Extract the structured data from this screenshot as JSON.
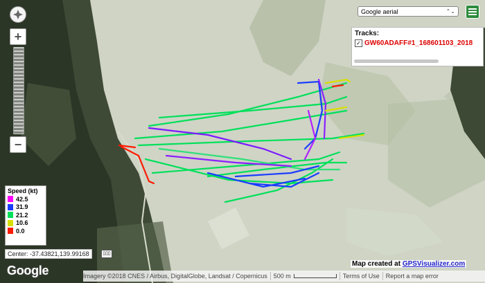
{
  "controls": {
    "map_type": "Google aerial"
  },
  "tracks_panel": {
    "title": "Tracks:",
    "track_name": "GW60ADAFF#1_168601103_2018"
  },
  "legend": {
    "title": "Speed (kt)",
    "items": [
      {
        "value": "42.5",
        "color": "#ff00ff"
      },
      {
        "value": "31.9",
        "color": "#1a3cff"
      },
      {
        "value": "21.2",
        "color": "#00e05a"
      },
      {
        "value": "10.6",
        "color": "#d7e000"
      },
      {
        "value": "0.0",
        "color": "#ff1a00"
      }
    ]
  },
  "center": "Center: -37.43821,139.99168",
  "google_logo": "Google",
  "credit": {
    "prefix": "Map created at ",
    "site": "GPSVisualizer.com"
  },
  "footer": {
    "imagery": "Imagery ©2018 CNES / Airbus, DigitalGlobe, Landsat / Copernicus",
    "scale": "500 m",
    "terms": "Terms of Use",
    "report": "Report a map error"
  }
}
